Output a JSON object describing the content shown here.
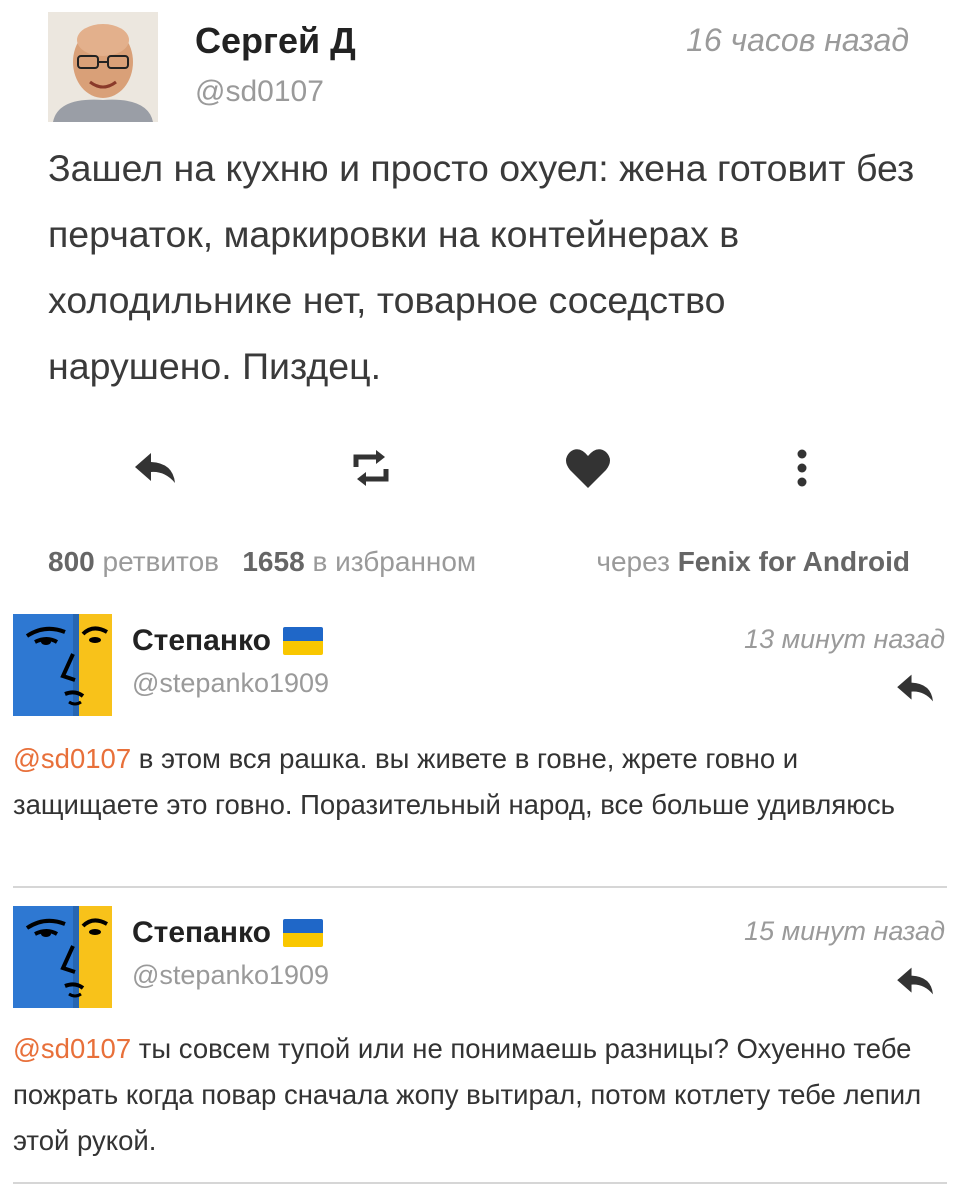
{
  "tweet": {
    "author_name": "Сергей Д",
    "handle": "@sd0107",
    "time": "16 часов назад",
    "text": "Зашел на кухню и просто охуел: жена готовит без перчаток, маркировки на контейнерах в холодильнике нет, товарное соседство нарушено. Пиздец.",
    "actions": [
      "reply-icon",
      "retweet-icon",
      "heart-icon",
      "more-icon"
    ],
    "retweets_count": "800",
    "retweets_label": "ретвитов",
    "favorites_count": "1658",
    "favorites_label": "в избранном",
    "via_label": "через",
    "client": "Fenix for Android"
  },
  "replies": [
    {
      "author_name": "Степанко",
      "handle": "@stepanko1909",
      "time": "13 минут назад",
      "mention": "@sd0107",
      "text": " в этом вся рашка. вы живете в говне, жрете говно и защищаете это говно. Поразительный народ, все больше удивляюсь"
    },
    {
      "author_name": "Степанко",
      "handle": "@stepanko1909",
      "time": "15 минут назад",
      "mention": "@sd0107",
      "text": " ты совсем тупой или не понимаешь разницы? Охуенно тебе пожрать когда повар сначала жопу вытирал, потом котлету тебе лепил этой рукой."
    }
  ],
  "colors": {
    "mention": "#e8703a",
    "flag_blue": "#1f67c8",
    "flag_yellow": "#f9c700",
    "avatar_blue": "#2e78d2",
    "avatar_yellow": "#f8c21a"
  }
}
